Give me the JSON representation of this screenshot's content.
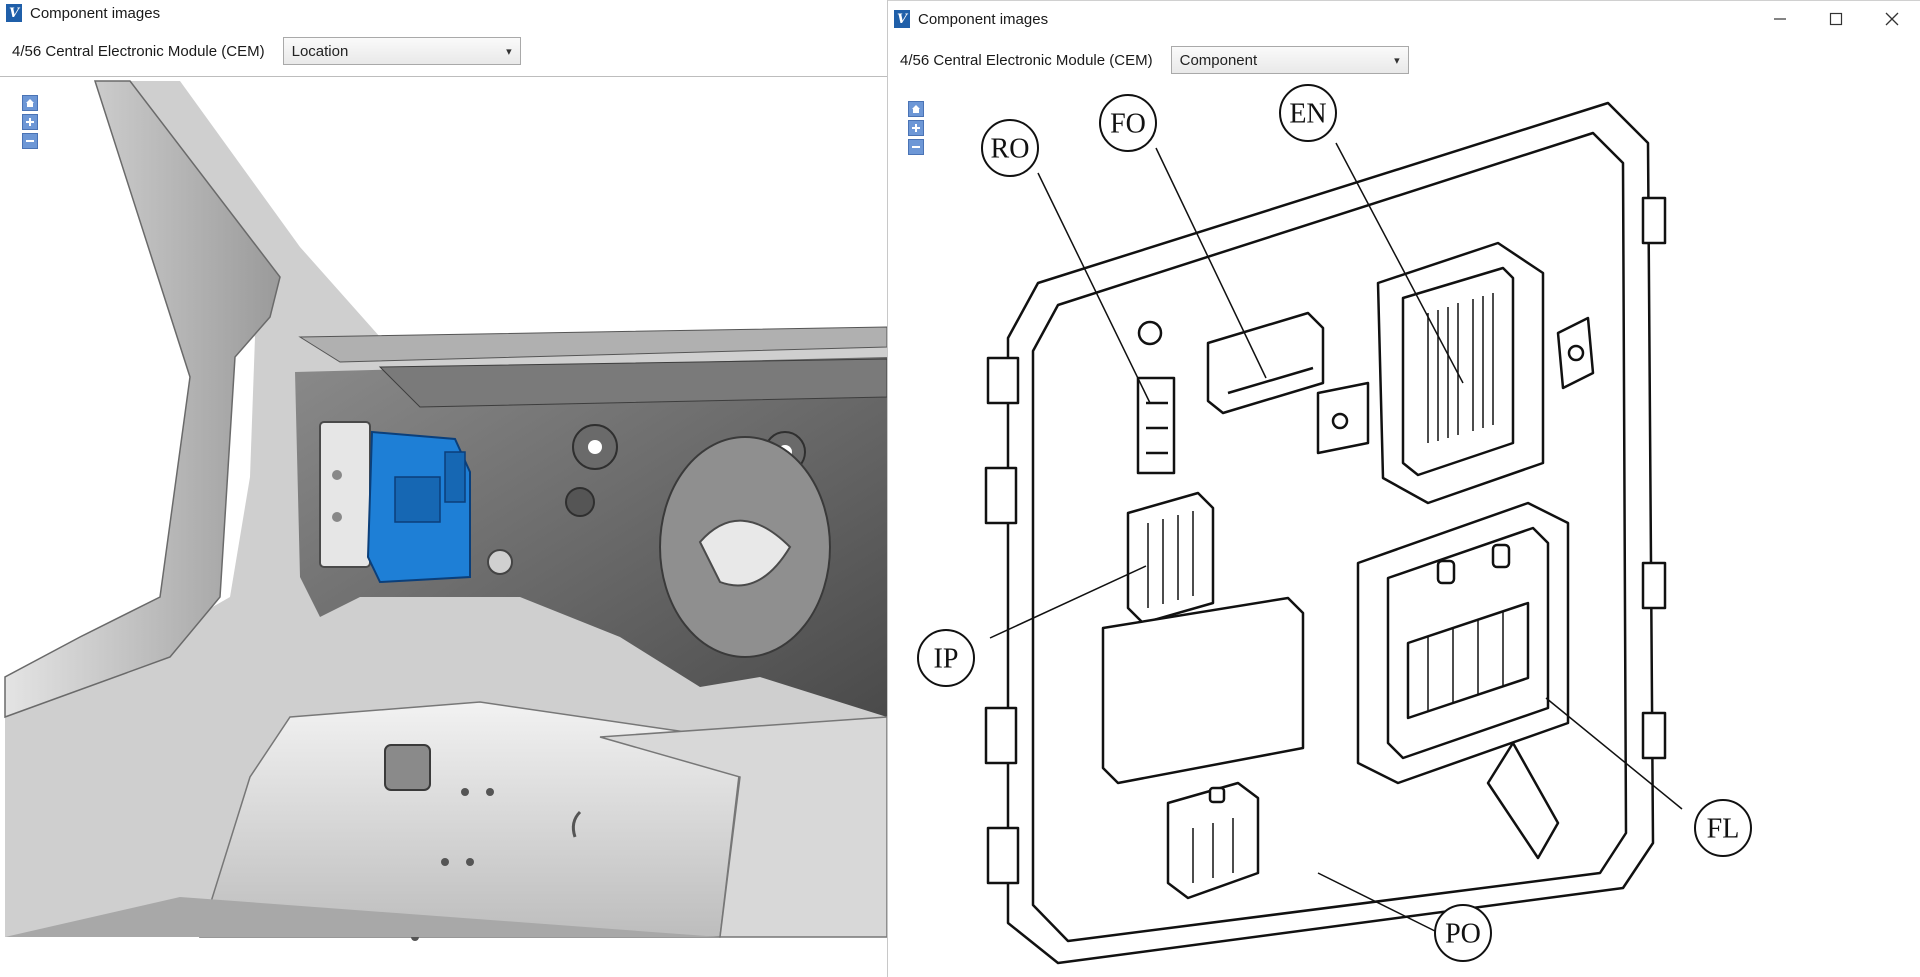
{
  "left_window": {
    "title": "Component images",
    "module_label": "4/56 Central Electronic Module (CEM)",
    "view_select": {
      "selected": "Location"
    }
  },
  "right_window": {
    "title": "Component images",
    "module_label": "4/56 Central Electronic Module (CEM)",
    "view_select": {
      "selected": "Component"
    },
    "callouts": {
      "ro": "RO",
      "fo": "FO",
      "en": "EN",
      "ip": "IP",
      "fl": "FL",
      "po": "PO"
    }
  },
  "zoom_tools": {
    "home": "home-icon",
    "zoom_in": "plus-icon",
    "zoom_out": "minus-icon"
  },
  "colors": {
    "brand": "#1f5fa9",
    "highlight_module": "#1e7fd6",
    "tool_button": "#6d97d6"
  }
}
